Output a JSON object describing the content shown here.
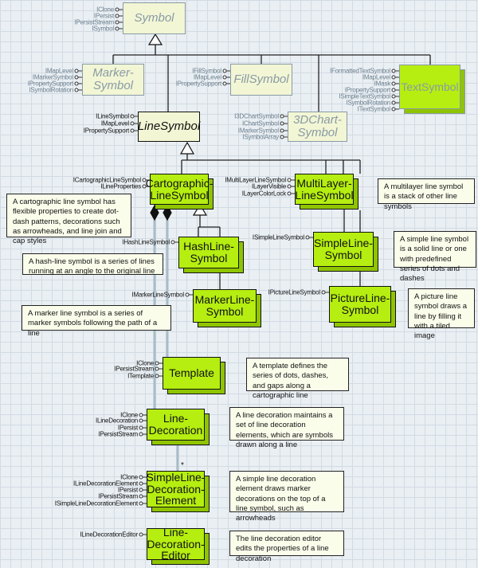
{
  "classes": [
    {
      "id": "symbol",
      "label": "Symbol",
      "kind": "abstract",
      "interfaces": [
        "IClone",
        "IPersist",
        "IPersistStream",
        "ISymbol"
      ]
    },
    {
      "id": "marker-symbol",
      "label": "Marker-\nSymbol",
      "kind": "abstract",
      "interfaces": [
        "IMapLevel",
        "IMarkerSymbol",
        "IPropertySupport",
        "ISymbolRotation"
      ]
    },
    {
      "id": "fill-symbol",
      "label": "FillSymbol",
      "kind": "abstract",
      "interfaces": [
        "IFillSymbol",
        "IMapLevel",
        "IPropertySupport"
      ]
    },
    {
      "id": "text-symbol",
      "label": "TextSymbol",
      "kind": "concrete-faded",
      "interfaces": [
        "IFormattedTextSymbol",
        "IMapLevel",
        "IMask",
        "IPropertySupport",
        "ISimpleTextSymbol",
        "ISymbolRotation",
        "ITextSymbol"
      ]
    },
    {
      "id": "line-symbol",
      "label": "LineSymbol",
      "kind": "abstract-focus",
      "interfaces": [
        "ILineSymbol",
        "IMapLevel",
        "IPropertySupport"
      ]
    },
    {
      "id": "3dchart-symbol",
      "label": "3DChart-\nSymbol",
      "kind": "abstract",
      "interfaces": [
        "I3DChartSymbol",
        "IChartSymbol",
        "IMarkerSymbol",
        "ISymbolArray"
      ]
    },
    {
      "id": "cartographic-line-symbol",
      "label": "Cartographic-\nLineSymbol",
      "kind": "concrete",
      "interfaces": [
        "ICartographicLineSymbol",
        "ILineProperties"
      ]
    },
    {
      "id": "multilayer-line-symbol",
      "label": "MultiLayer-\nLineSymbol",
      "kind": "concrete",
      "interfaces": [
        "IMultiLayerLineSymbol",
        "ILayerVisible",
        "ILayerColorLock"
      ]
    },
    {
      "id": "hash-line-symbol",
      "label": "HashLine-\nSymbol",
      "kind": "concrete",
      "interfaces": [
        "IHashLineSymbol"
      ]
    },
    {
      "id": "simple-line-symbol",
      "label": "SimpleLine-\nSymbol",
      "kind": "concrete",
      "interfaces": [
        "ISimpleLineSymbol"
      ]
    },
    {
      "id": "marker-line-symbol",
      "label": "MarkerLine-\nSymbol",
      "kind": "concrete",
      "interfaces": [
        "IMarkerLineSymbol"
      ]
    },
    {
      "id": "picture-line-symbol",
      "label": "PictureLine-\nSymbol",
      "kind": "concrete",
      "interfaces": [
        "IPictureLineSymbol"
      ]
    },
    {
      "id": "template",
      "label": "Template",
      "kind": "concrete",
      "interfaces": [
        "IClone",
        "IPersistStream",
        "ITemplate"
      ]
    },
    {
      "id": "line-decoration",
      "label": "Line-\nDecoration",
      "kind": "concrete",
      "interfaces": [
        "IClone",
        "ILineDecoration",
        "IPersist",
        "IPersistStream"
      ]
    },
    {
      "id": "simple-line-decoration-element",
      "label": "SimpleLine-\nDecoration-\nElement",
      "kind": "concrete",
      "interfaces": [
        "IClone",
        "ILineDecorationElement",
        "IPersist",
        "IPersistStream",
        "ISimpleLineDecorationElement"
      ]
    },
    {
      "id": "line-decoration-editor",
      "label": "Line-\nDecoration-\nEditor",
      "kind": "concrete",
      "interfaces": [
        "ILineDecorationEditor"
      ]
    }
  ],
  "callouts": [
    {
      "id": "multilayer",
      "text": "A multilayer line symbol is a stack of other line symbols"
    },
    {
      "id": "cartographic",
      "text": "A cartographic line symbol has flexible properties to create dot-dash patterns, decorations such as arrowheads, and line join and cap styles"
    },
    {
      "id": "hash",
      "text": "A hash-line symbol is a series of lines running at an angle to the original line"
    },
    {
      "id": "simple",
      "text": "A simple line symbol is a solid line or one with predefined series of dots and dashes"
    },
    {
      "id": "marker",
      "text": "A marker line symbol is a series of marker symbols following the path of a line"
    },
    {
      "id": "picture",
      "text": "A picture line symbol draws a line by filling it with a tiled image"
    },
    {
      "id": "template",
      "text": "A template defines the series of dots, dashes, and gaps along a cartographic line"
    },
    {
      "id": "line-decoration",
      "text": "A line decoration maintains a set of line decoration elements, which are symbols drawn along a line"
    },
    {
      "id": "simple-line-decoration-element",
      "text": "A simple line decoration element draws marker decorations on the top of a line symbol, such as arrowheads"
    },
    {
      "id": "line-decoration-editor",
      "text": "The line decoration editor edits the properties of a line decoration"
    }
  ],
  "multiplicity": "*",
  "colors": {
    "concrete_fill": "#b5ee10",
    "abstract_fill": "#f2f6d4",
    "background": "#e9eff3",
    "composition_line": "#a9bcc8"
  }
}
